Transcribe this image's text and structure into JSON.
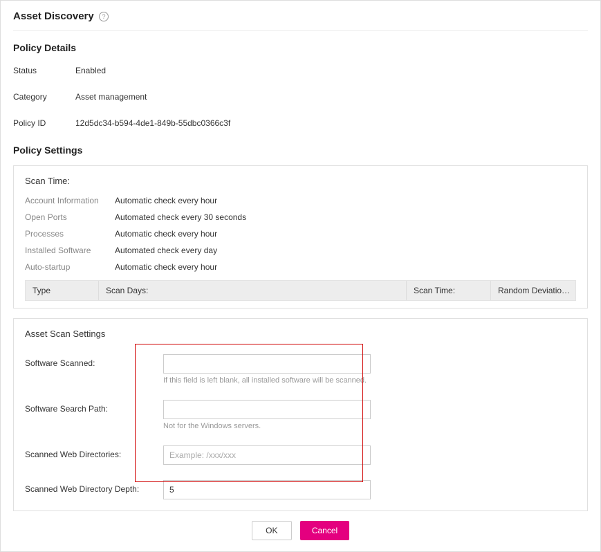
{
  "title": "Asset Discovery",
  "help_icon_label": "help-icon",
  "policy_details": {
    "heading": "Policy Details",
    "status_label": "Status",
    "status_value": "Enabled",
    "category_label": "Category",
    "category_value": "Asset management",
    "policy_id_label": "Policy ID",
    "policy_id_value": "12d5dc34-b594-4de1-849b-55dbc0366c3f"
  },
  "policy_settings": {
    "heading": "Policy Settings",
    "scan_time": {
      "title": "Scan Time:",
      "rows": [
        {
          "label": "Account Information",
          "value": "Automatic check every hour"
        },
        {
          "label": "Open Ports",
          "value": "Automated check every 30 seconds"
        },
        {
          "label": "Processes",
          "value": "Automatic check every hour"
        },
        {
          "label": "Installed Software",
          "value": "Automated check every day"
        },
        {
          "label": "Auto-startup",
          "value": "Automatic check every hour"
        }
      ],
      "columns": {
        "type": "Type",
        "scan_days": "Scan Days:",
        "scan_time": "Scan Time:",
        "random_deviation": "Random Deviatio…"
      }
    },
    "asset_scan": {
      "title": "Asset Scan Settings",
      "software_scanned": {
        "label": "Software Scanned:",
        "value": "",
        "hint": "If this field is left blank, all installed software will be scanned."
      },
      "software_search_path": {
        "label": "Software Search Path:",
        "value": "",
        "hint": "Not for the Windows servers."
      },
      "scanned_web_dirs": {
        "label": "Scanned Web Directories:",
        "value": "",
        "placeholder": "Example: /xxx/xxx"
      },
      "scanned_web_depth": {
        "label": "Scanned Web Directory Depth:",
        "value": "5"
      }
    }
  },
  "actions": {
    "ok": "OK",
    "cancel": "Cancel"
  }
}
